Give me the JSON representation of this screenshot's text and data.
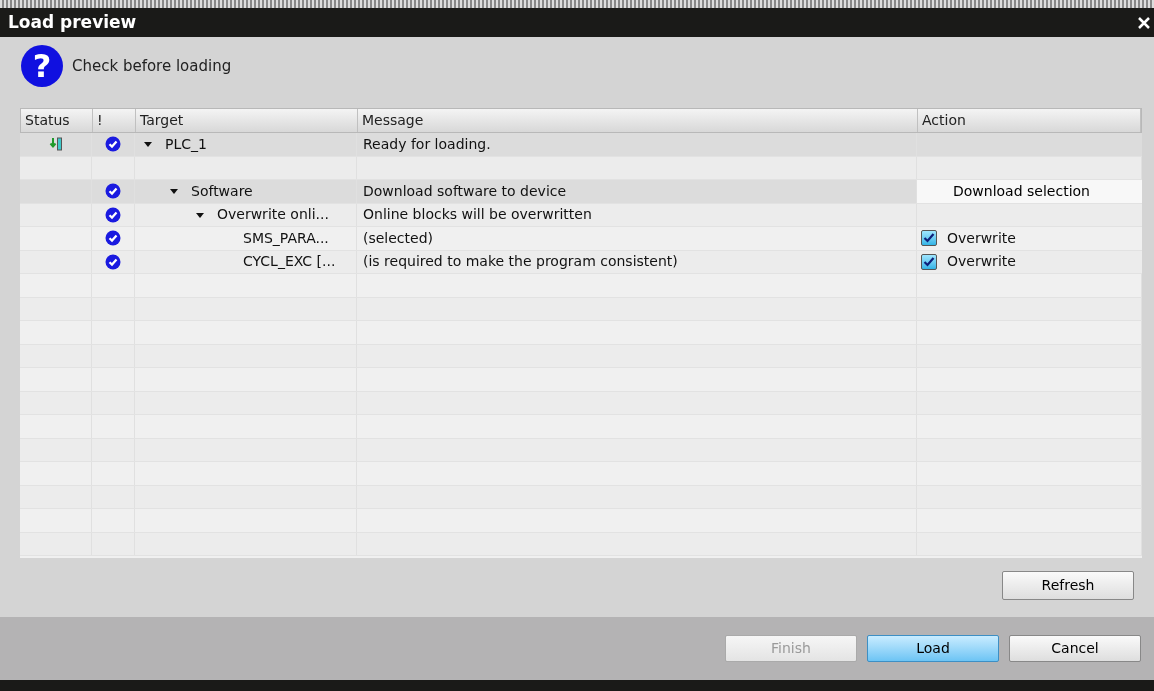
{
  "window": {
    "title": "Load preview"
  },
  "header": {
    "icon_text": "?",
    "text": "Check before loading"
  },
  "table": {
    "columns": [
      "Status",
      "!",
      "Target",
      "Message",
      "Action"
    ],
    "rows": [
      {
        "kind": "item",
        "status": {
          "kind": "download"
        },
        "ok": true,
        "target": "PLC_1",
        "expanded": true,
        "selected": true,
        "message": "Ready for loading.",
        "children": [
          {
            "kind": "blank"
          },
          {
            "kind": "item",
            "ok": true,
            "target": "Software",
            "expanded": true,
            "selected": true,
            "message": "Download software to device",
            "action": {
              "kind": "dropdown",
              "label": "Download selection"
            },
            "children": [
              {
                "kind": "item",
                "ok": true,
                "target": "Overwrite onli...",
                "expanded": true,
                "selected": false,
                "message": "Online blocks will be overwritten",
                "children": [
                  {
                    "kind": "item",
                    "ok": true,
                    "target": "SMS_PARA...",
                    "selected": false,
                    "message": "(selected)",
                    "action": {
                      "kind": "checkbox",
                      "label": "Overwrite",
                      "checked": true
                    }
                  },
                  {
                    "kind": "item",
                    "ok": true,
                    "target": "CYCL_EXC [...",
                    "selected": false,
                    "message": "(is required to make the program consistent)",
                    "action": {
                      "kind": "checkbox",
                      "label": "Overwrite",
                      "checked": true
                    }
                  }
                ]
              }
            ]
          }
        ]
      }
    ]
  },
  "refresh_button": {
    "label": "Refresh"
  },
  "buttons": [
    {
      "label": "Finish",
      "disabled": true,
      "primary": false
    },
    {
      "label": "Load",
      "disabled": false,
      "primary": true
    },
    {
      "label": "Cancel",
      "disabled": false,
      "primary": false
    }
  ]
}
